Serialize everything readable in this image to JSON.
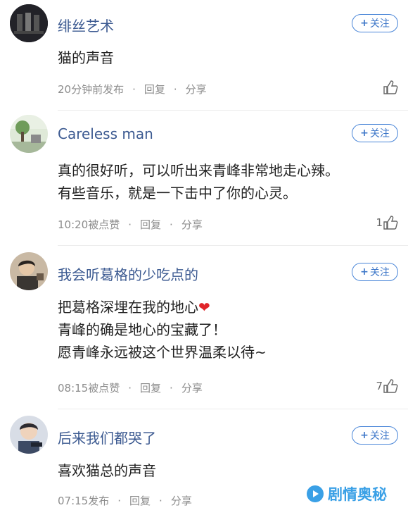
{
  "comments": [
    {
      "username": "绯丝艺术",
      "follow_label": "关注",
      "lines": [
        "猫的声音"
      ],
      "time": "20分钟前发布",
      "reply": "回复",
      "share": "分享",
      "likes": ""
    },
    {
      "username": "Careless man",
      "follow_label": "关注",
      "lines": [
        "真的很好听，可以听出来青峰非常地走心辣。",
        "有些音乐，就是一下击中了你的心灵。"
      ],
      "time": "10:20被点赞",
      "reply": "回复",
      "share": "分享",
      "likes": "1"
    },
    {
      "username": "我会听葛格的少吃点的",
      "follow_label": "关注",
      "lines": [
        "把葛格深埋在我的地心",
        "青峰的确是地心的宝藏了！",
        "愿青峰永远被这个世界温柔以待~"
      ],
      "heart": "❤",
      "time": "08:15被点赞",
      "reply": "回复",
      "share": "分享",
      "likes": "7"
    },
    {
      "username": "后来我们都哭了",
      "follow_label": "关注",
      "lines": [
        "喜欢猫总的声音"
      ],
      "time": "07:15发布",
      "reply": "回复",
      "share": "分享",
      "likes": ""
    }
  ],
  "watermark": "剧情奥秘",
  "colors": {
    "username": "#3c5a91",
    "follow": "#4a86d8",
    "heart": "#e0252a",
    "watermark": "#3aa0e6"
  }
}
